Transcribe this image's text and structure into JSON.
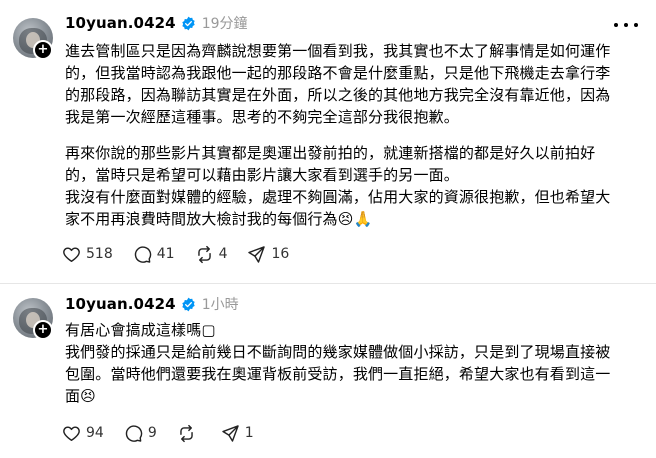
{
  "posts": [
    {
      "username": "10yuan.0424",
      "time": "19分鐘",
      "paragraphs": [
        [
          "進去管制區只是因為齊麟說想要第一個看到我，我其實也不太了解事情是如何運作",
          "的，但我當時認為我跟他一起的那段路不會是什麼重點，只是他下飛機走去拿行李",
          "的那段路，因為聯訪其實是在外面，所以之後的其他地方我完全沒有靠近他，因為",
          "我是第一次經歷這種事。思考的不夠完全這部分我很抱歉。"
        ],
        [
          "再來你說的那些影片其實都是奧運出發前拍的，就連新搭檔的都是好久以前拍好",
          "的，當時只是希望可以藉由影片讓大家看到選手的另一面。",
          "我沒有什麼面對媒體的經驗，處理不夠圓滿，佔用大家的資源很抱歉，但也希望大",
          "家不用再浪費時間放大檢討我的每個行為😣🙏"
        ]
      ],
      "likes": "518",
      "comments": "41",
      "reposts": "4",
      "shares": "16"
    },
    {
      "username": "10yuan.0424",
      "time": "1小時",
      "paragraphs": [
        [
          "有居心會搞成這樣嗎▢",
          "我們發的採通只是給前幾日不斷詢問的幾家媒體做個小採訪，只是到了現場直接被",
          "包圍。當時他們還要我在奧運背板前受訪，我們一直拒絕，希望大家也有看到這一",
          "面😣"
        ]
      ],
      "likes": "94",
      "comments": "9",
      "reposts": "",
      "shares": "1"
    }
  ],
  "icons": {
    "verified": "verified-badge-icon",
    "like": "heart-icon",
    "comment": "comment-icon",
    "repost": "repost-icon",
    "share": "share-icon",
    "more": "more-dots-icon",
    "follow": "plus-icon"
  },
  "colors": {
    "verified": "#0095f6",
    "time": "#999999",
    "divider": "#e6e6e6"
  }
}
